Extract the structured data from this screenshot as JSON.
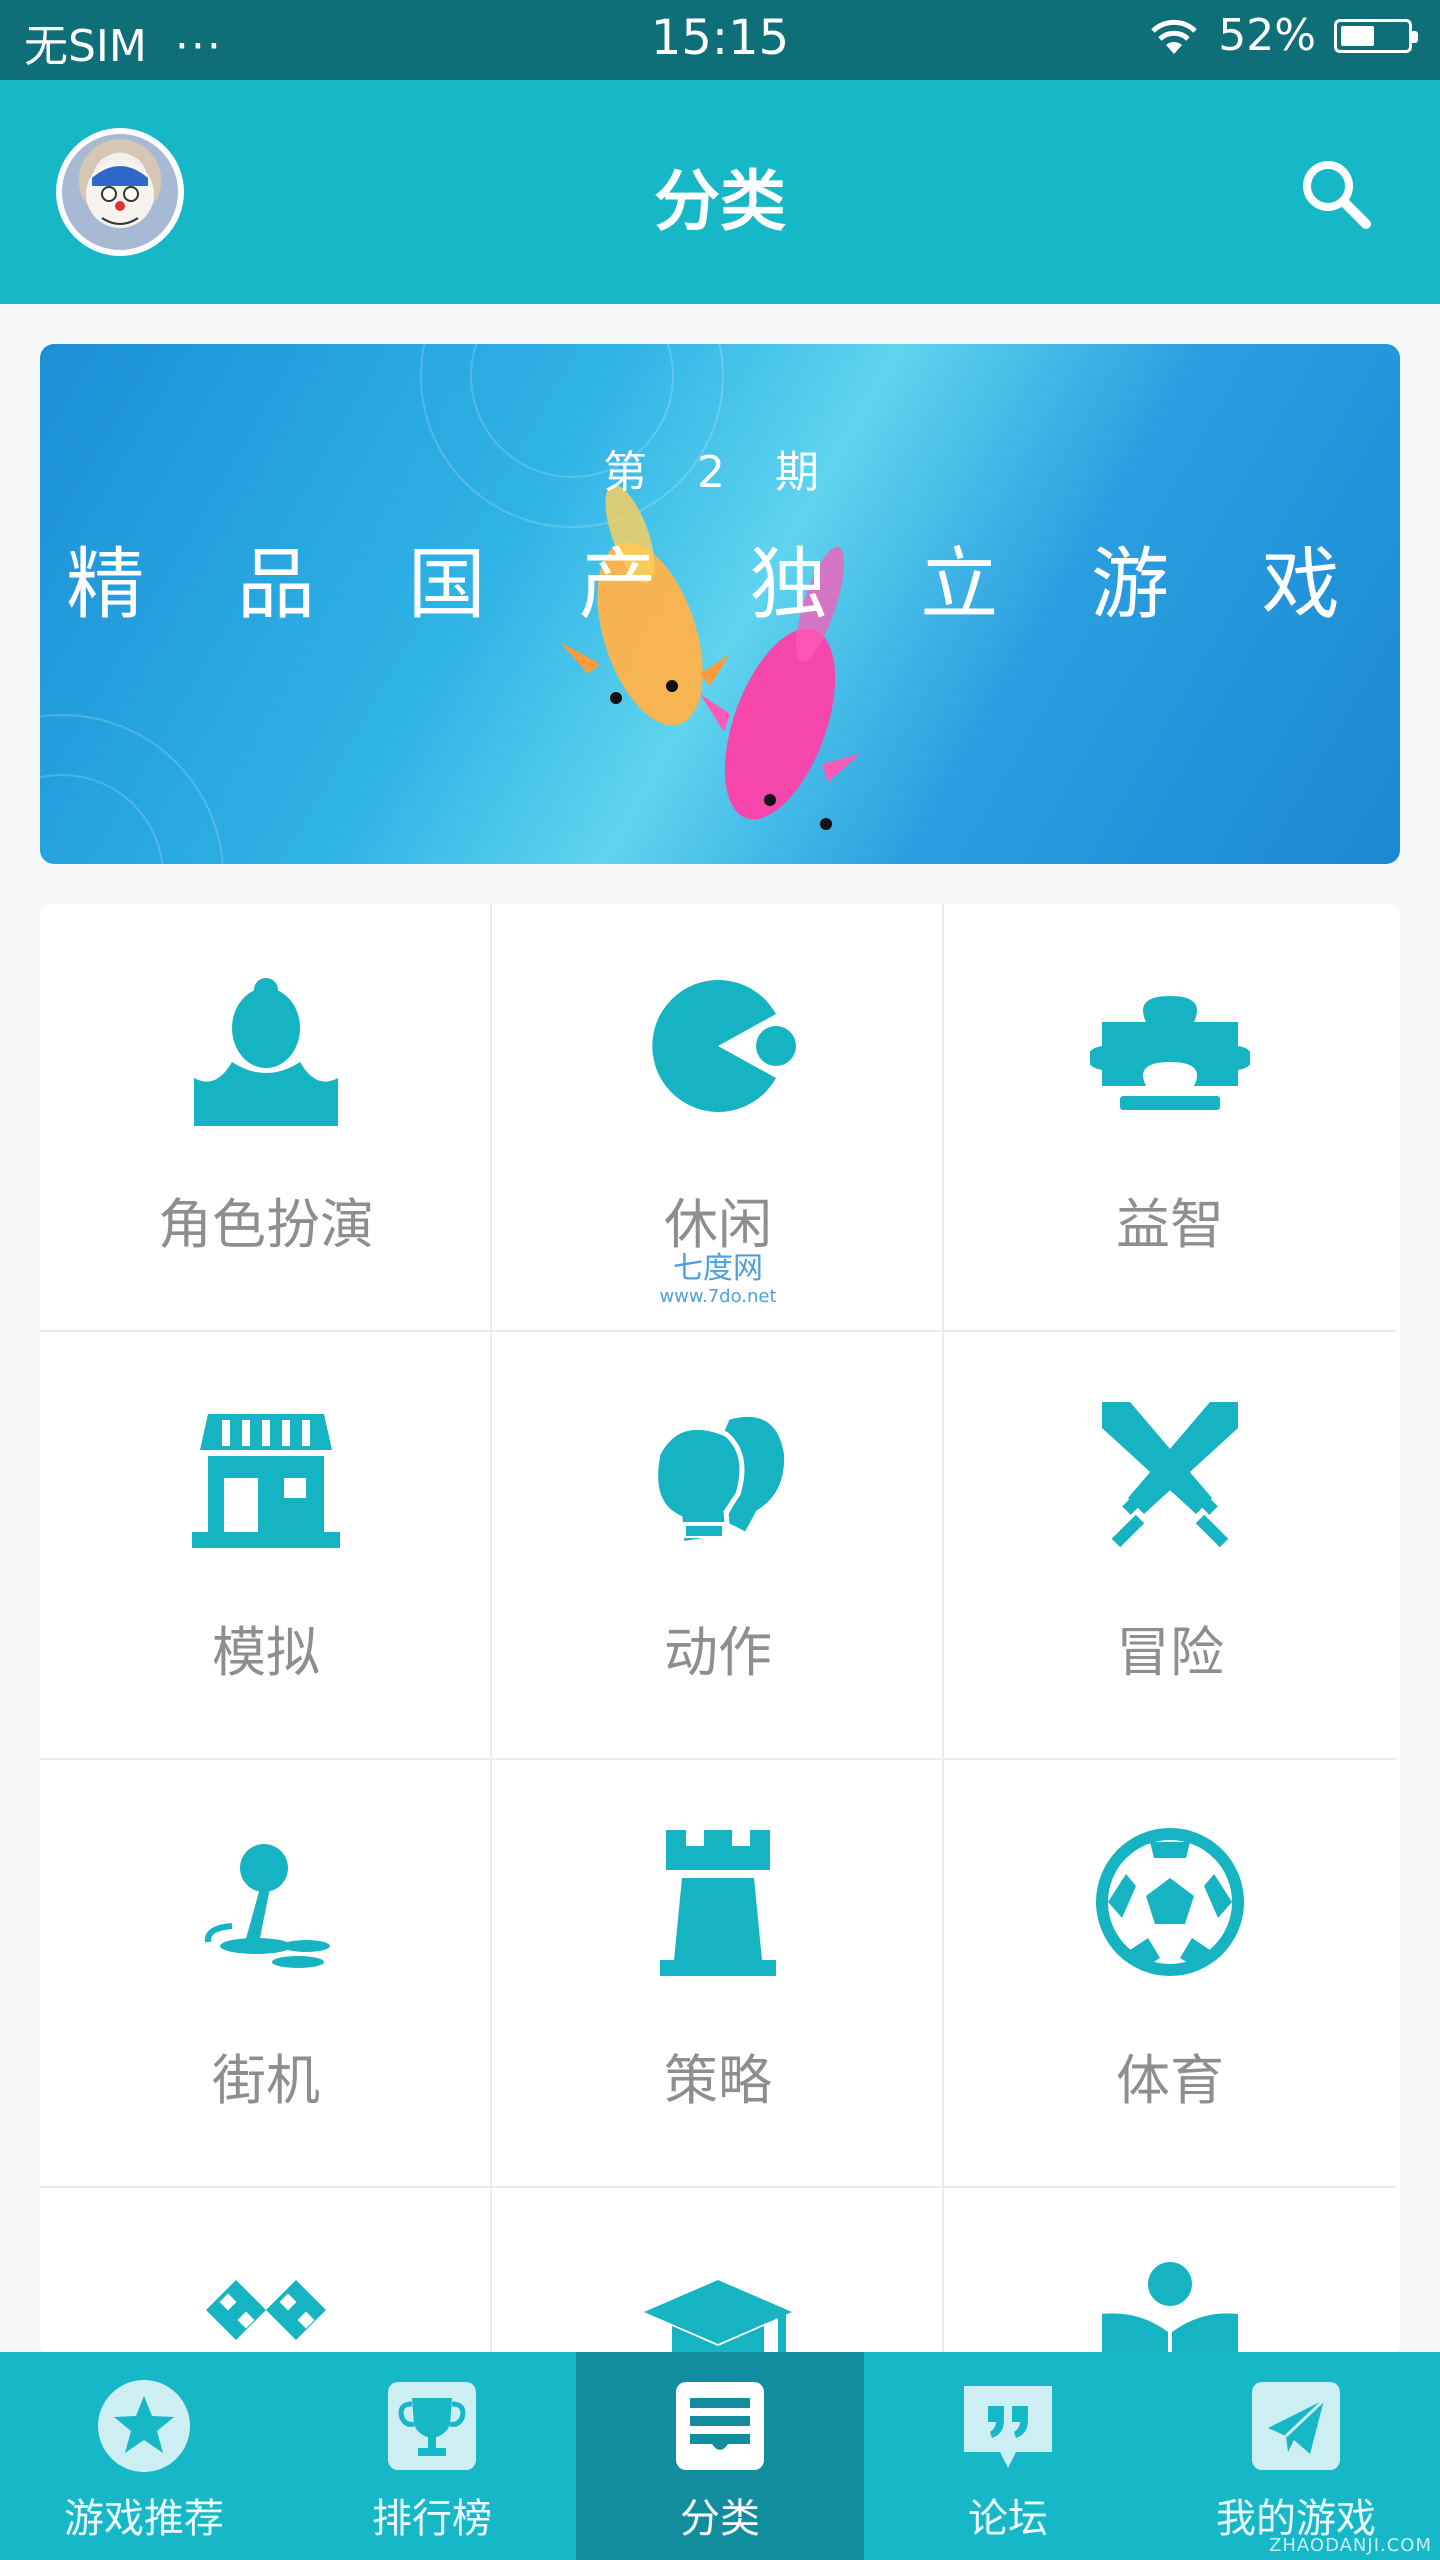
{
  "status_bar": {
    "carrier": "无SIM",
    "dots": "···",
    "time": "15:15",
    "battery_percent": "52%",
    "battery_level": 0.52
  },
  "header": {
    "title": "分类"
  },
  "banner": {
    "issue": "第 2 期",
    "headline": "精 品 国 产 独 立 游 戏"
  },
  "categories": [
    {
      "label": "角色扮演",
      "icon": "role-playing-icon"
    },
    {
      "label": "休闲",
      "icon": "pacman-icon"
    },
    {
      "label": "益智",
      "icon": "puzzle-icon"
    },
    {
      "label": "模拟",
      "icon": "shop-icon"
    },
    {
      "label": "动作",
      "icon": "boxing-glove-icon"
    },
    {
      "label": "冒险",
      "icon": "crossed-swords-icon"
    },
    {
      "label": "街机",
      "icon": "joystick-icon"
    },
    {
      "label": "策略",
      "icon": "chess-rook-icon"
    },
    {
      "label": "体育",
      "icon": "soccer-ball-icon"
    },
    {
      "label": "",
      "icon": "racing-flags-icon"
    },
    {
      "label": "",
      "icon": "graduation-cap-icon"
    },
    {
      "label": "",
      "icon": "reader-icon"
    }
  ],
  "watermark": {
    "line1": "七度网",
    "line2": "www.7do.net"
  },
  "bottom_nav": [
    {
      "label": "游戏推荐",
      "icon": "star-icon"
    },
    {
      "label": "排行榜",
      "icon": "trophy-icon"
    },
    {
      "label": "分类",
      "icon": "category-icon",
      "active": true
    },
    {
      "label": "论坛",
      "icon": "forum-quote-icon"
    },
    {
      "label": "我的游戏",
      "icon": "paper-plane-icon"
    }
  ],
  "corner_mark": "ZHAODANJI.COM",
  "colors": {
    "primary": "#16b7c6",
    "status_bar": "#0f6f79",
    "active_tab": "#118d9d",
    "icon": "#16b3c2",
    "label_gray": "#8e8e8e"
  }
}
